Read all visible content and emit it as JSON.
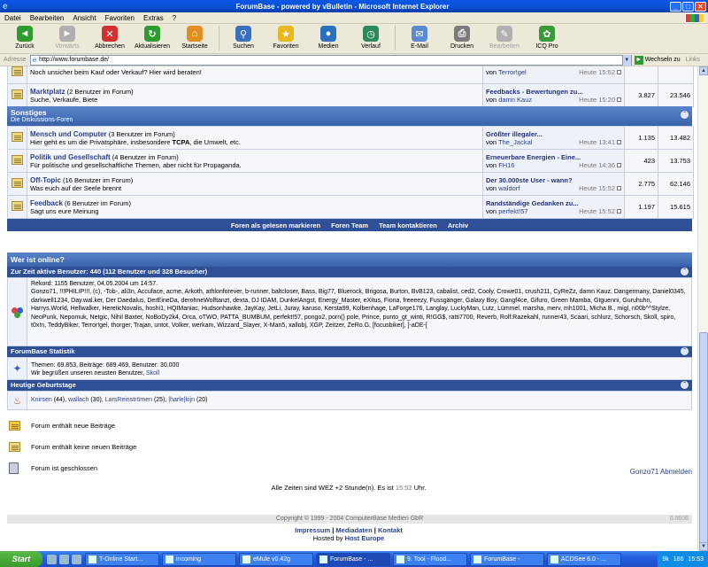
{
  "window": {
    "title": "ForumBase - powered by vBulletin - Microsoft Internet Explorer"
  },
  "menu": [
    "Datei",
    "Bearbeiten",
    "Ansicht",
    "Favoriten",
    "Extras",
    "?"
  ],
  "toolbar": [
    {
      "label": "Zurück",
      "icon": "back-icon",
      "color": "#2f9a2f",
      "glyph": "◄"
    },
    {
      "label": "Vorwärts",
      "icon": "forward-icon",
      "color": "#b0b0b0",
      "glyph": "►",
      "disabled": true
    },
    {
      "label": "Abbrechen",
      "icon": "stop-icon",
      "color": "#d03030",
      "glyph": "✕"
    },
    {
      "label": "Aktualisieren",
      "icon": "refresh-icon",
      "color": "#2f9a2f",
      "glyph": "↻"
    },
    {
      "label": "Startseite",
      "icon": "home-icon",
      "color": "#e09020",
      "glyph": "⌂"
    },
    {
      "label": "Suchen",
      "icon": "search-icon",
      "color": "#3a70c0",
      "glyph": "⚲"
    },
    {
      "label": "Favoriten",
      "icon": "star-icon",
      "color": "#e8b820",
      "glyph": "★"
    },
    {
      "label": "Medien",
      "icon": "media-icon",
      "color": "#2a70c0",
      "glyph": "●"
    },
    {
      "label": "Verlauf",
      "icon": "history-icon",
      "color": "#2a8a5a",
      "glyph": "◷"
    },
    {
      "label": "E-Mail",
      "icon": "mail-icon",
      "color": "#5a8ad0",
      "glyph": "✉"
    },
    {
      "label": "Drucken",
      "icon": "print-icon",
      "color": "#7a7a7a",
      "glyph": "⎙"
    },
    {
      "label": "Bearbeiten",
      "icon": "edit-icon",
      "color": "#b0b0b0",
      "glyph": "✎",
      "disabled": true
    },
    {
      "label": "ICQ Pro",
      "icon": "icq-icon",
      "color": "#3a9a3a",
      "glyph": "✿"
    }
  ],
  "address": {
    "label": "Adresse",
    "url": "http://www.forumbase.de/",
    "go": "Wechseln zu",
    "links": "Links"
  },
  "top_forums": [
    {
      "name": "",
      "count": "",
      "desc": "Noch unsicher beim Kauf oder Verkauf? Hier wird beraten!",
      "last_title": "",
      "last_by_prefix": "von",
      "last_by": "Terror!gel",
      "last_time": "Heute 15:52",
      "threads": "",
      "posts": ""
    },
    {
      "name": "Marktplatz",
      "count": "(2 Benutzer im Forum)",
      "desc": "Suche, Verkaufe, Biete",
      "last_title": "Feedbacks - Bewertungen zu...",
      "last_by_prefix": "von",
      "last_by": "damn Kauz",
      "last_time": "Heute 15:20",
      "threads": "3.827",
      "posts": "23.546"
    }
  ],
  "category": {
    "title": "Sonstiges",
    "subtitle": "Die Diskussions-Foren"
  },
  "forums": [
    {
      "name": "Mensch und Computer",
      "count": "(3 Benutzer im Forum)",
      "desc_parts": [
        "Hier geht es um die Privatsphäre, insbesondere ",
        "TCPA",
        ", die Umwelt, etc."
      ],
      "last_title": "Größter illegaler...",
      "last_by_prefix": "von",
      "last_by": "The_Jackal",
      "last_time": "Heute 13:41",
      "threads": "1.135",
      "posts": "13.482"
    },
    {
      "name": "Politik und Gesellschaft",
      "count": "(4 Benutzer im Forum)",
      "desc_parts": [
        "Für politische und gesellschaftliche Themen, aber nicht für Propaganda.",
        "",
        ""
      ],
      "last_title": "Erneuerbare Energien - Eine...",
      "last_by_prefix": "von",
      "last_by": "FH16",
      "last_time": "Heute 14:36",
      "threads": "423",
      "posts": "13.753"
    },
    {
      "name": "Off-Topic",
      "count": "(16 Benutzer im Forum)",
      "desc_parts": [
        "Was euch auf der Seele brennt",
        "",
        ""
      ],
      "last_title": "Der 30.000ste User - wann?",
      "last_by_prefix": "von",
      "last_by": "waldorf",
      "last_time": "Heute 15:52",
      "threads": "2.775",
      "posts": "62.146"
    },
    {
      "name": "Feedback",
      "count": "(6 Benutzer im Forum)",
      "desc_parts": [
        "Sagt uns eure Meinung",
        "",
        ""
      ],
      "last_title": "Randständige Gedanken zu...",
      "last_by_prefix": "von",
      "last_by": "perfekt!57",
      "last_time": "Heute 15:52",
      "threads": "1.197",
      "posts": "15.615"
    }
  ],
  "footer_links": [
    "Foren als gelesen markieren",
    "Foren Team",
    "Team kontaktieren",
    "Archiv"
  ],
  "wio": {
    "title": "Wer ist online?",
    "active_header": "Zur Zeit aktive Benutzer: 440 (112 Benutzer und 328 Besucher)",
    "record": "Rekord: 1155 Benutzer, 04.05.2004 um 14:57.",
    "users": "Gonzo71, !!!PHILIP!!!, (c), -Tob-, ali3n, Accuface, acme, Arkoth, athlonforever, b-runner, baltcloser, Bass, Big77, Bluerock, Brigosa, Burton, BvB123, cabalist, ced2, Cooly, Crowe01, crush211, CyReZz, damn Kauz, Dangermany, Daniel0345, darkwell1234, Day.wal.ker, Der Daedalus, DerEineDa, derohneWolftanzt, dexta, DJ IDAM, DunkelAngst, Energy_Master, eXitus, Fiona, freeeezy, Fussgänger, Galaxy Boy, Gangf4ce, Gifuro, Green Mamba, Gtguenni, Guruhuhn, Harrys.World, Hellwalker, HereticNovalis, hoshi1, HQIManiac, Hudsonhawke, JayKay, JetLi, Juray, karuso, Kersta99, Kolbenhage, LaForge176, Langlay, LuckyMan, Lutz, Lümmel, marsha, merv, mh1001, Micha B., migl, n00b^^Stylze, NeoPunk, Nepomuk, Netgic, Nihil Baxter, NoBoDy2k4, Orca, oTWO, PATTA_BUMBUM, perfekt!57, pongo2, porn() pole, Prince, punto_gt_winti, R!GG$, ratti7700, Reverb, Rolf:Razekahl, runner43, Scaari, schlurz, Schorsch, Skoll, spiro, t0x!n, TeddyBiker, Terror!gel, thorger, Trajan, untot, Volker, werkam, Wizzard_Slayer, X-Man5, xallobj, XGP, Zeitzer, ZeRo.G, [focusbiker], ]-aDE-[",
    "stats_header": "ForumBase Statistik",
    "stats": "Themen: 69.853, Beiträge: 689.469, Benutzer: 30.000",
    "welcome_prefix": "Wir begrüßen unseren neusten Benutzer, ",
    "welcome_user": "Skoll",
    "bday_header": "Heutige Geburtstage",
    "birthdays": [
      {
        "name": "Knirsen",
        "age": "(44)"
      },
      {
        "name": "wallach",
        "age": "(30)"
      },
      {
        "name": "LarsReinströmen",
        "age": "(25)"
      },
      {
        "name": "|harle|kijn",
        "age": "(20)"
      }
    ]
  },
  "legend": {
    "new": "Forum enthält neue Beiträge",
    "nonew": "Forum enthält keine neuen Beiträge",
    "closed": "Forum ist geschlossen"
  },
  "user_logout": "Gonzo71 Abmelden",
  "timezone": "Alle Zeiten sind WEZ +2 Stunde(n). Es ist",
  "time_now": "15:52",
  "time_suffix": "Uhr.",
  "copyright": "Copyright © 1999 - 2004 ComputerBase Medien GbR",
  "version": "0.0606",
  "bottom_links": [
    "Impressum",
    "Mediadaten",
    "Kontakt"
  ],
  "hosted_prefix": "Hosted by",
  "hosted_by": "Host Europe",
  "taskbar": {
    "start": "Start",
    "tasks": [
      {
        "label": "T-Online Start...",
        "active": false
      },
      {
        "label": "incoming",
        "active": false
      },
      {
        "label": "eMule v0.42g",
        "active": false
      },
      {
        "label": "ForumBase - ...",
        "active": true
      },
      {
        "label": "9. Tool - Flood...",
        "active": false
      },
      {
        "label": "ForumBase -",
        "active": false
      },
      {
        "label": "ACDSee 6.0 - ...",
        "active": false
      }
    ],
    "tray_a": "9k",
    "tray_b": "186",
    "clock": "15:53"
  }
}
